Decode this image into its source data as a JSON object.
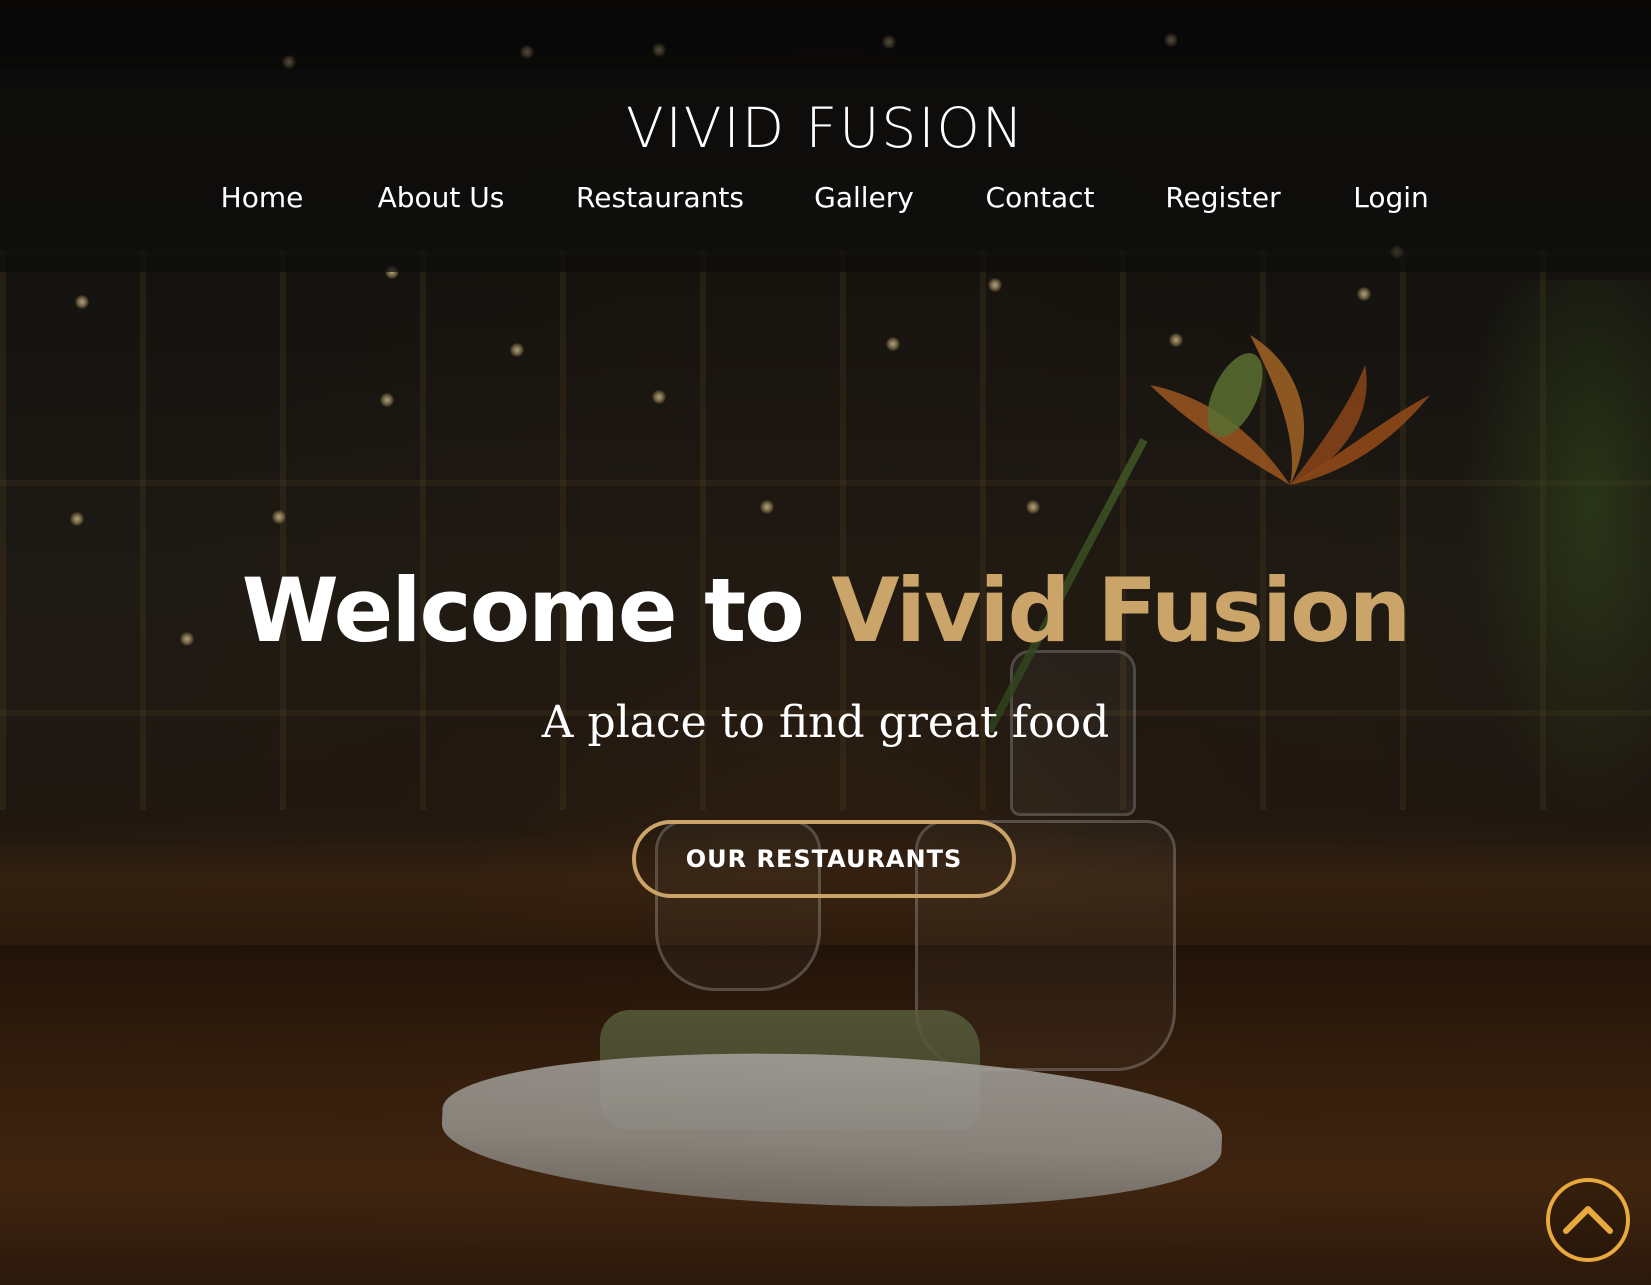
{
  "brand": {
    "name": "VIVID FUSION"
  },
  "nav": {
    "items": [
      {
        "label": "Home"
      },
      {
        "label": "About Us"
      },
      {
        "label": "Restaurants"
      },
      {
        "label": "Gallery"
      },
      {
        "label": "Contact"
      },
      {
        "label": "Register"
      },
      {
        "label": "Login"
      }
    ]
  },
  "hero": {
    "title_part1": "Welcome to ",
    "title_part2": "Vivid Fusion",
    "subtitle": "A place to find great food",
    "cta_label": "OUR RESTAURANTS"
  },
  "scroll_top": {
    "icon": "chevron-up-icon"
  },
  "colors": {
    "accent_gold": "#caa468",
    "scroll_button_orange": "#e8aa3d",
    "text_white": "#ffffff",
    "header_bg": "rgba(12,12,12,0.72)"
  }
}
